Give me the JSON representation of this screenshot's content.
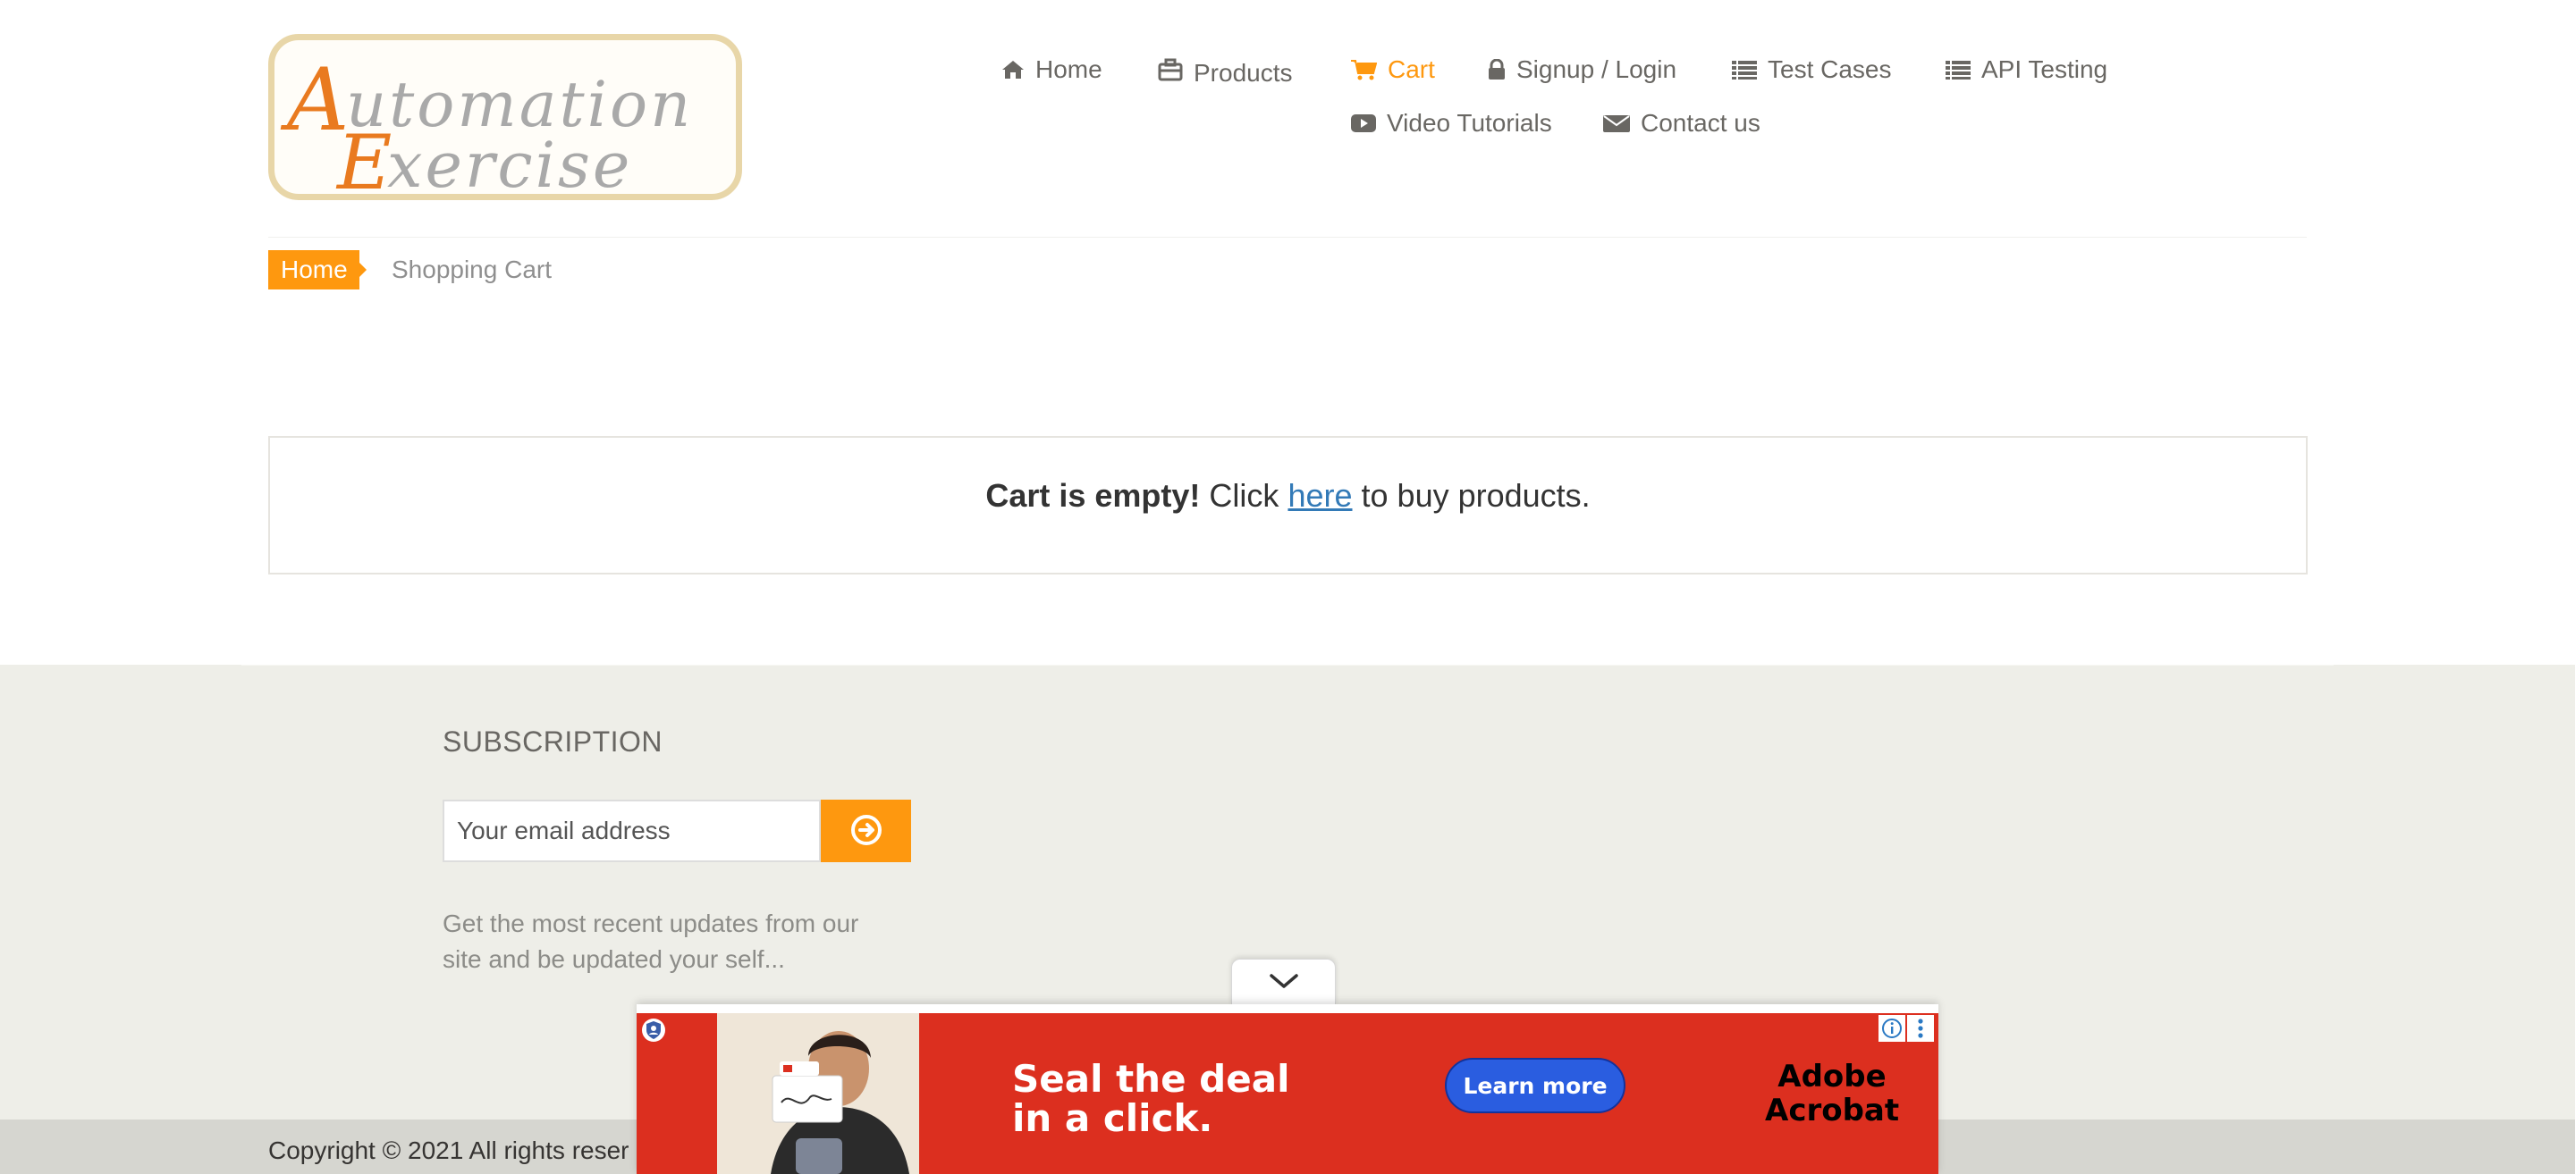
{
  "logo": {
    "line1": "Automation",
    "line2": "Exercise"
  },
  "nav": {
    "items": [
      {
        "label": "Home",
        "icon": "home-icon"
      },
      {
        "label": "Products",
        "icon": "briefcase-icon"
      },
      {
        "label": "Cart",
        "icon": "shopping-cart-icon",
        "active": true
      },
      {
        "label": "Signup / Login",
        "icon": "lock-icon"
      },
      {
        "label": "Test Cases",
        "icon": "list-icon"
      },
      {
        "label": "API Testing",
        "icon": "list-icon"
      },
      {
        "label": "Video Tutorials",
        "icon": "youtube-play-icon"
      },
      {
        "label": "Contact us",
        "icon": "envelope-icon"
      }
    ]
  },
  "breadcrumb": {
    "home": "Home",
    "current": "Shopping Cart"
  },
  "cart": {
    "empty_bold": "Cart is empty!",
    "click_text": "Click",
    "link_text": "here",
    "after_text": "to buy products."
  },
  "footer": {
    "subscription_title": "SUBSCRIPTION",
    "email_placeholder": "Your email address",
    "subscribe_icon": "arrow-circle-right-icon",
    "description": "Get the most recent updates from our site and be updated your self...",
    "copyright": "Copyright © 2021 All rights reser"
  },
  "ad": {
    "headline_line1": "Seal the deal",
    "headline_line2": "in a click.",
    "cta": "Learn more",
    "brand_line1": "Adobe",
    "brand_line2": "Acrobat"
  },
  "colors": {
    "accent": "#fe980f",
    "link": "#337ab7",
    "footer_bg": "#eeeee8",
    "ad_red": "#dc2f1f",
    "ad_button": "#2a5de0"
  }
}
